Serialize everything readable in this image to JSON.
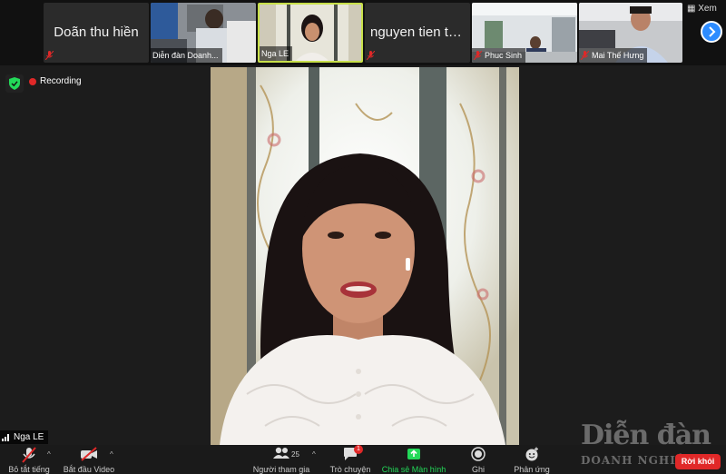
{
  "gallery": {
    "tiles": [
      {
        "name": "Doãn thu hiền",
        "caption": "",
        "muted": true,
        "type": "name"
      },
      {
        "name": "",
        "caption": "Diễn đàn Doanh...",
        "muted": false,
        "type": "video"
      },
      {
        "name": "",
        "caption": "Nga LE",
        "muted": false,
        "type": "video",
        "active": true
      },
      {
        "name": "nguyen tien th...",
        "caption": "",
        "muted": true,
        "type": "name"
      },
      {
        "name": "",
        "caption": "Phuc Sinh",
        "muted": true,
        "type": "video"
      },
      {
        "name": "",
        "caption": "Mai Thế Hưng",
        "muted": true,
        "type": "video"
      }
    ],
    "view_label": "Xem"
  },
  "status": {
    "recording_label": "Recording"
  },
  "speaker": {
    "name": "Nga LE"
  },
  "toolbar": {
    "mute_label": "Bỏ tắt tiếng",
    "video_label": "Bắt đầu Video",
    "participants_label": "Người tham gia",
    "participants_count": "25",
    "chat_label": "Trò chuyện",
    "chat_badge": "1",
    "share_label": "Chia sẻ Màn hình",
    "record_label": "Ghi",
    "reactions_label": "Phản ứng",
    "leave_label": "Rời khỏi"
  },
  "watermark": {
    "line1": "Diễn đàn",
    "line2": "DOANH NGHIỆP"
  },
  "colors": {
    "accent": "#2d8cff",
    "share": "#23d959",
    "danger": "#e02828",
    "active_border": "#c8e04a"
  }
}
